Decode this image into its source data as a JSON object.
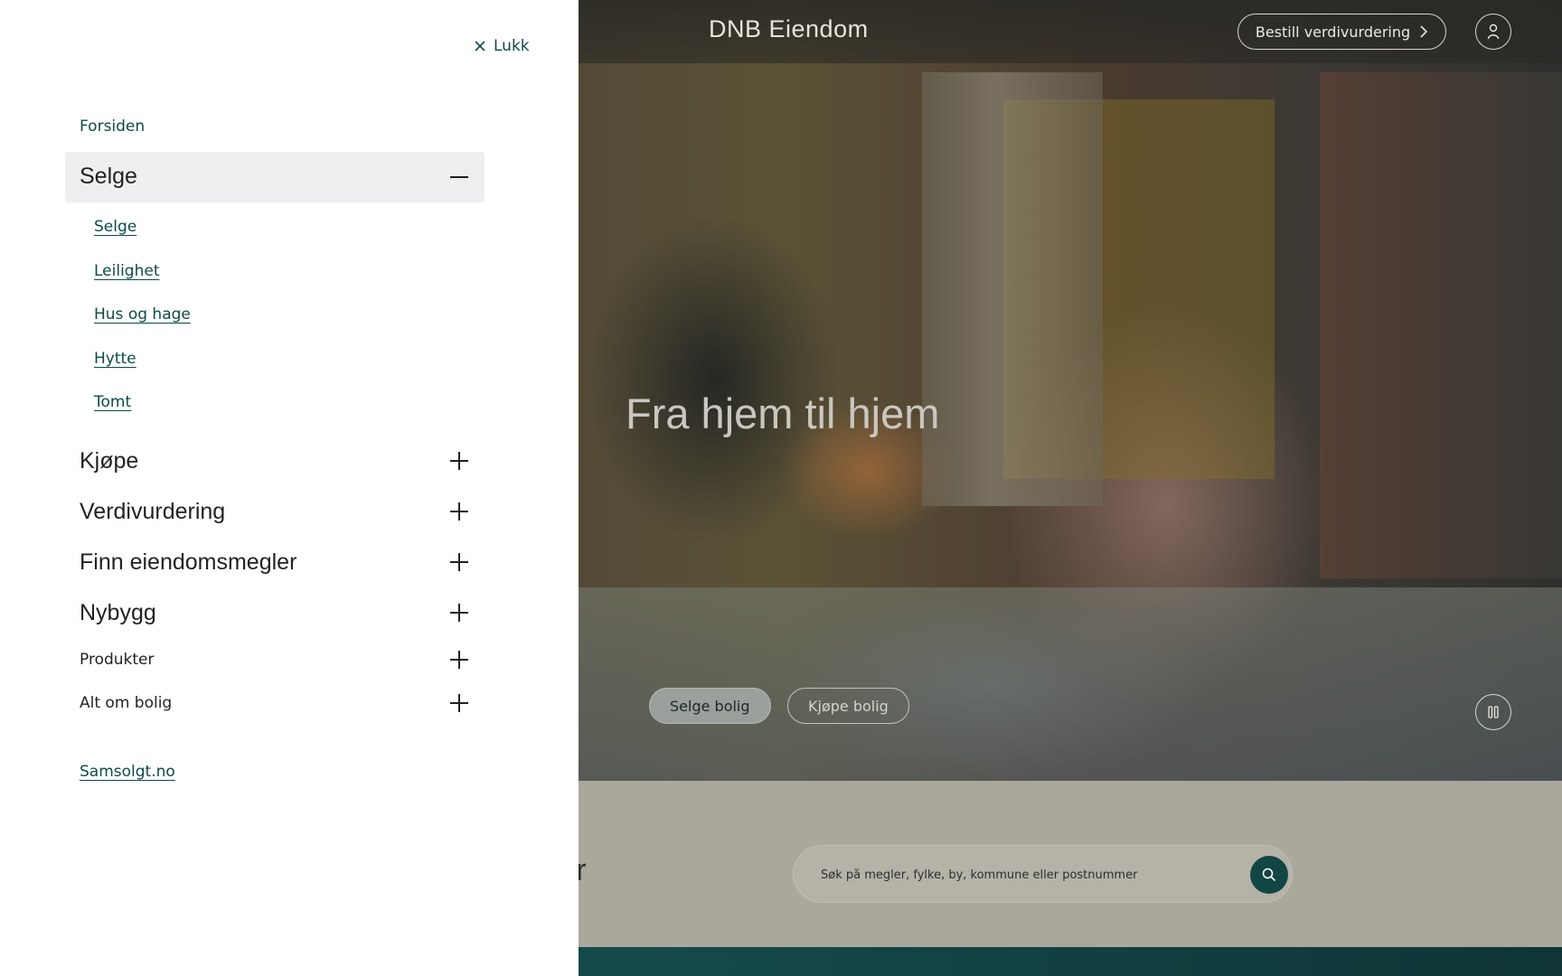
{
  "header": {
    "logo": "DNB Eiendom",
    "order_valuation": "Bestill verdivurdering"
  },
  "hero": {
    "title": "Fra hjem til hjem",
    "sell_button": "Selge bolig",
    "buy_button": "Kjøpe bolig"
  },
  "office_section": {
    "title_fragment": "ntor",
    "search_placeholder": "Søk på megler, fylke, by, kommune eller postnummer"
  },
  "drawer": {
    "close_label": "Lukk",
    "home_link": "Forsiden",
    "sections": [
      {
        "label": "Selge",
        "expanded": true
      },
      {
        "label": "Kjøpe",
        "expanded": false
      },
      {
        "label": "Verdivurdering",
        "expanded": false
      },
      {
        "label": "Finn eiendomsmegler",
        "expanded": false
      },
      {
        "label": "Nybygg",
        "expanded": false
      },
      {
        "label": "Produkter",
        "expanded": false
      },
      {
        "label": "Alt om bolig",
        "expanded": false
      }
    ],
    "selge_sub_links": [
      "Selge",
      "Leilighet",
      "Hus og hage",
      "Hytte",
      "Tomt"
    ],
    "external_link": "Samsolgt.no"
  },
  "colors": {
    "brand_teal": "#0d4a48",
    "search_button": "#124644",
    "accordion_open_bg": "#efeff2"
  },
  "icons": {
    "close": "close-icon",
    "collapse": "minus-icon",
    "expand": "plus-icon",
    "profile": "user-icon",
    "pause": "pause-icon",
    "search": "search-icon",
    "chevron": "chevron-right-icon"
  }
}
